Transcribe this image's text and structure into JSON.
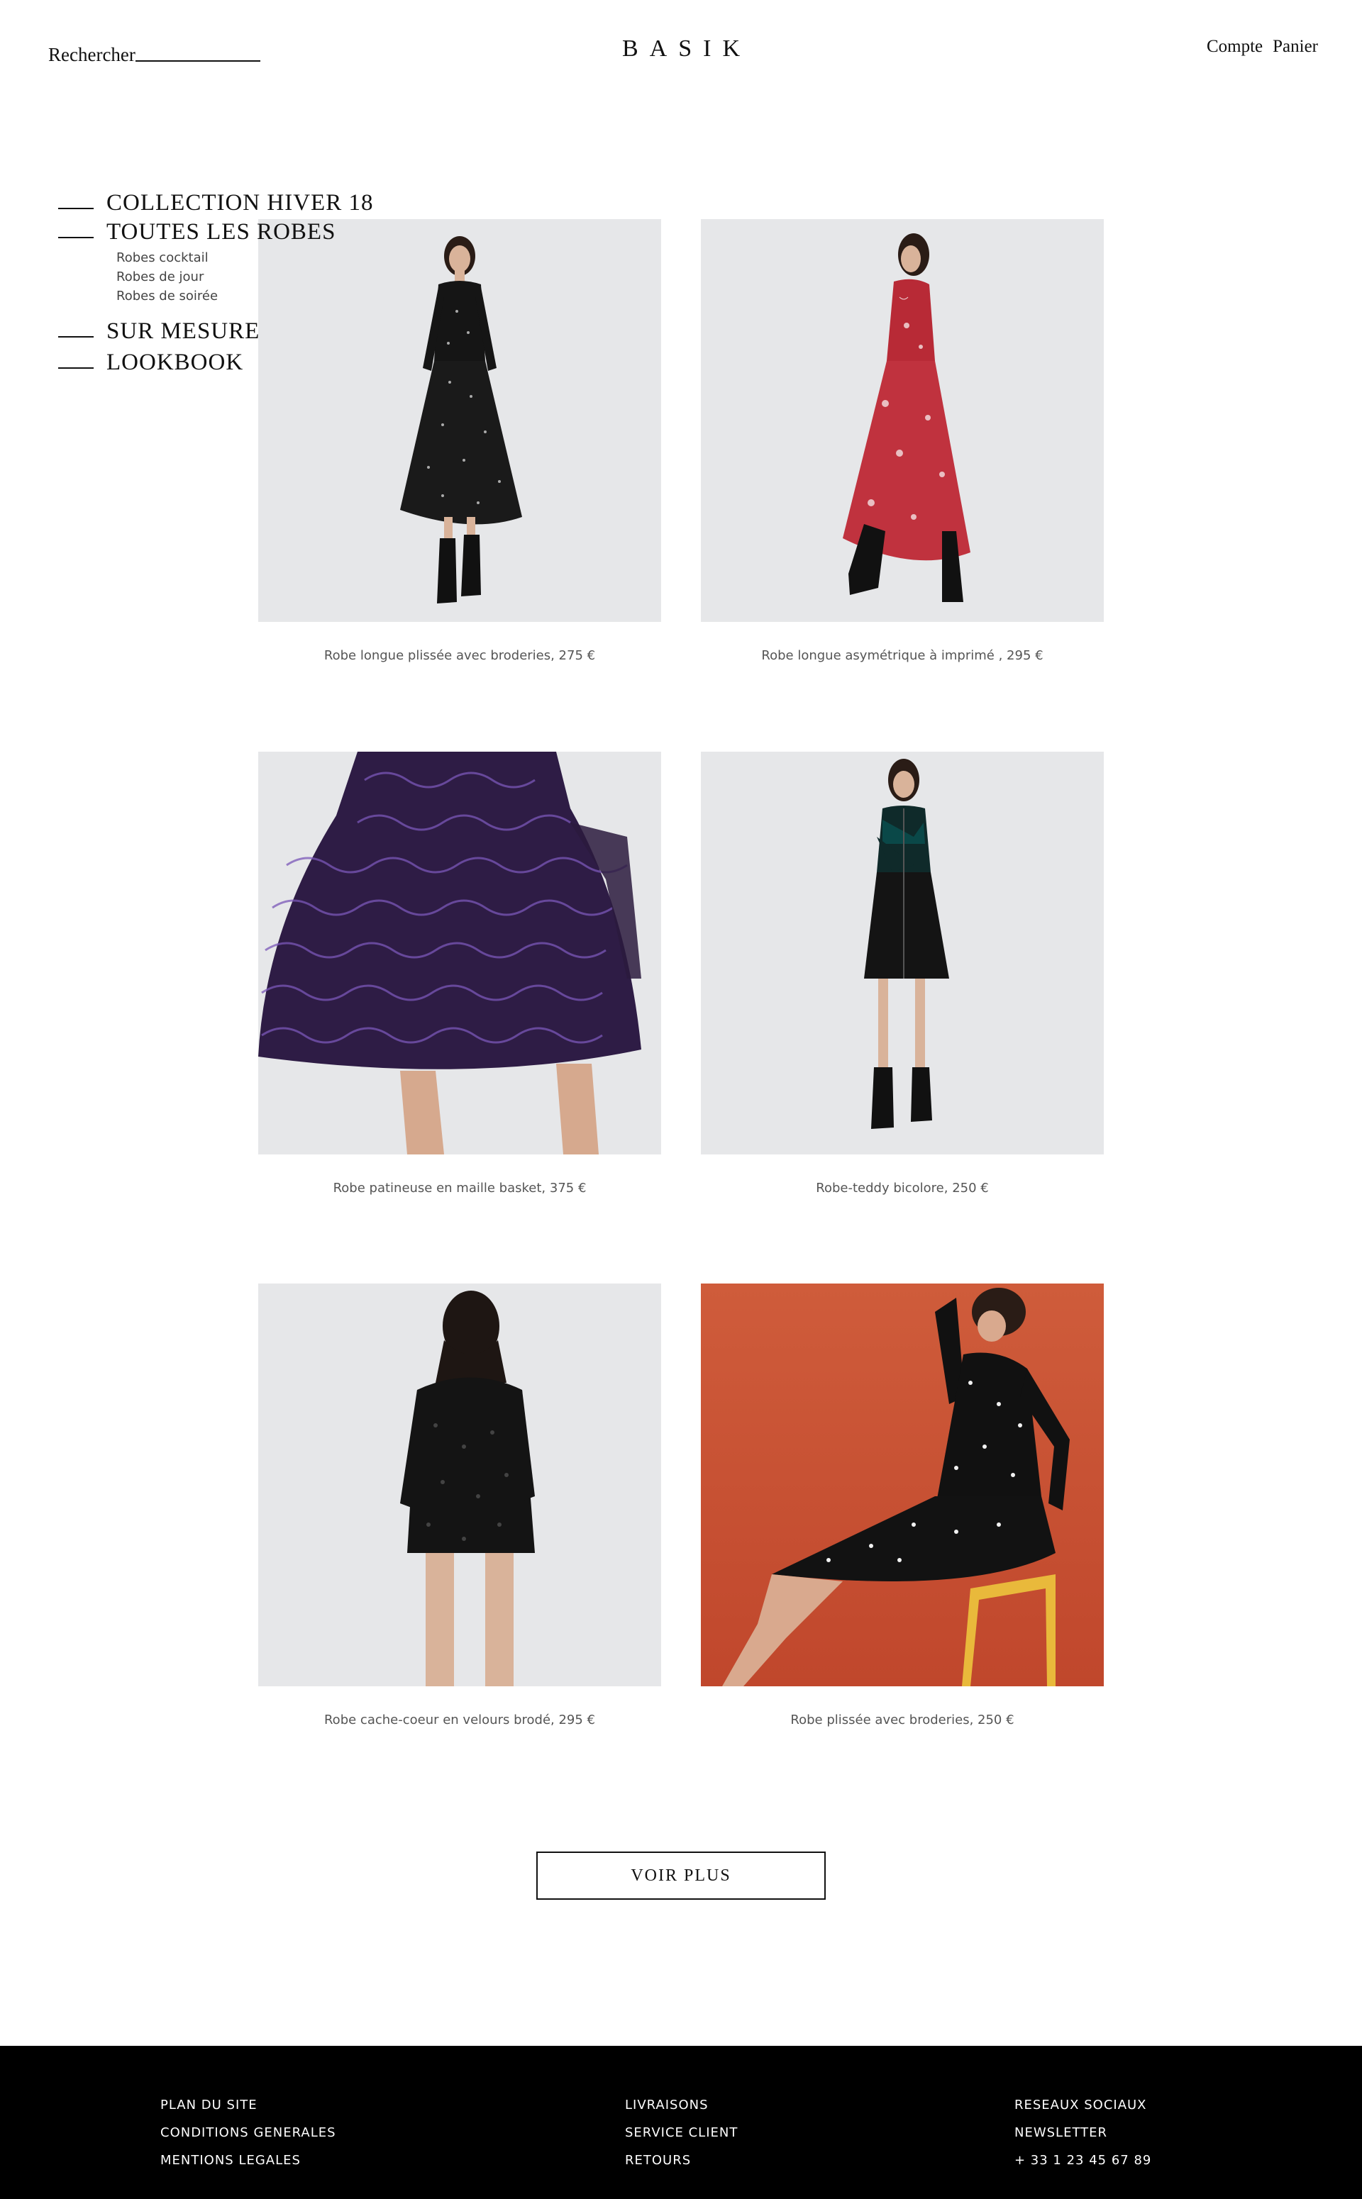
{
  "header": {
    "search_label": "Rechercher",
    "logo_text": "BASIK",
    "account_label": "Compte",
    "cart_label": "Panier"
  },
  "sidenav": {
    "items": [
      {
        "label": "COLLECTION HIVER 18"
      },
      {
        "label": "TOUTES LES ROBES"
      },
      {
        "label": "SUR MESURE"
      },
      {
        "label": "LOOKBOOK"
      }
    ],
    "sub_items": [
      {
        "label": "Robes cocktail"
      },
      {
        "label": "Robes de jour"
      },
      {
        "label": "Robes de soirée"
      }
    ]
  },
  "products": [
    {
      "caption": "Robe longue plissée avec broderies, 275 €",
      "image": "model-black-polka-long-dress"
    },
    {
      "caption": "Robe longue asymétrique à imprimé , 295 €",
      "image": "model-red-print-long-dress"
    },
    {
      "caption": "Robe patineuse en maille basket, 375 €",
      "image": "purple-lace-skater-dress"
    },
    {
      "caption": "Robe-teddy bicolore, 250 €",
      "image": "model-teddy-dress"
    },
    {
      "caption": "Robe cache-coeur en velours brodé, 295 €",
      "image": "model-velvet-wrap-dress-back"
    },
    {
      "caption": "Robe plissée avec broderies, 250 €",
      "image": "model-seated-polka-dress-orange-bg"
    }
  ],
  "voir_plus_label": "VOIR PLUS",
  "footer": {
    "col1": [
      "PLAN DU SITE",
      "CONDITIONS GENERALES",
      "MENTIONS LEGALES"
    ],
    "col2": [
      "LIVRAISONS",
      "SERVICE CLIENT",
      "RETOURS"
    ],
    "col3": [
      "RESEAUX SOCIAUX",
      "NEWSLETTER",
      "+ 33 1 23 45 67 89"
    ]
  },
  "colors": {
    "photo_bg": "#e6e7e9",
    "accent_orange": "#c9532f",
    "footer_bg": "#000000"
  }
}
